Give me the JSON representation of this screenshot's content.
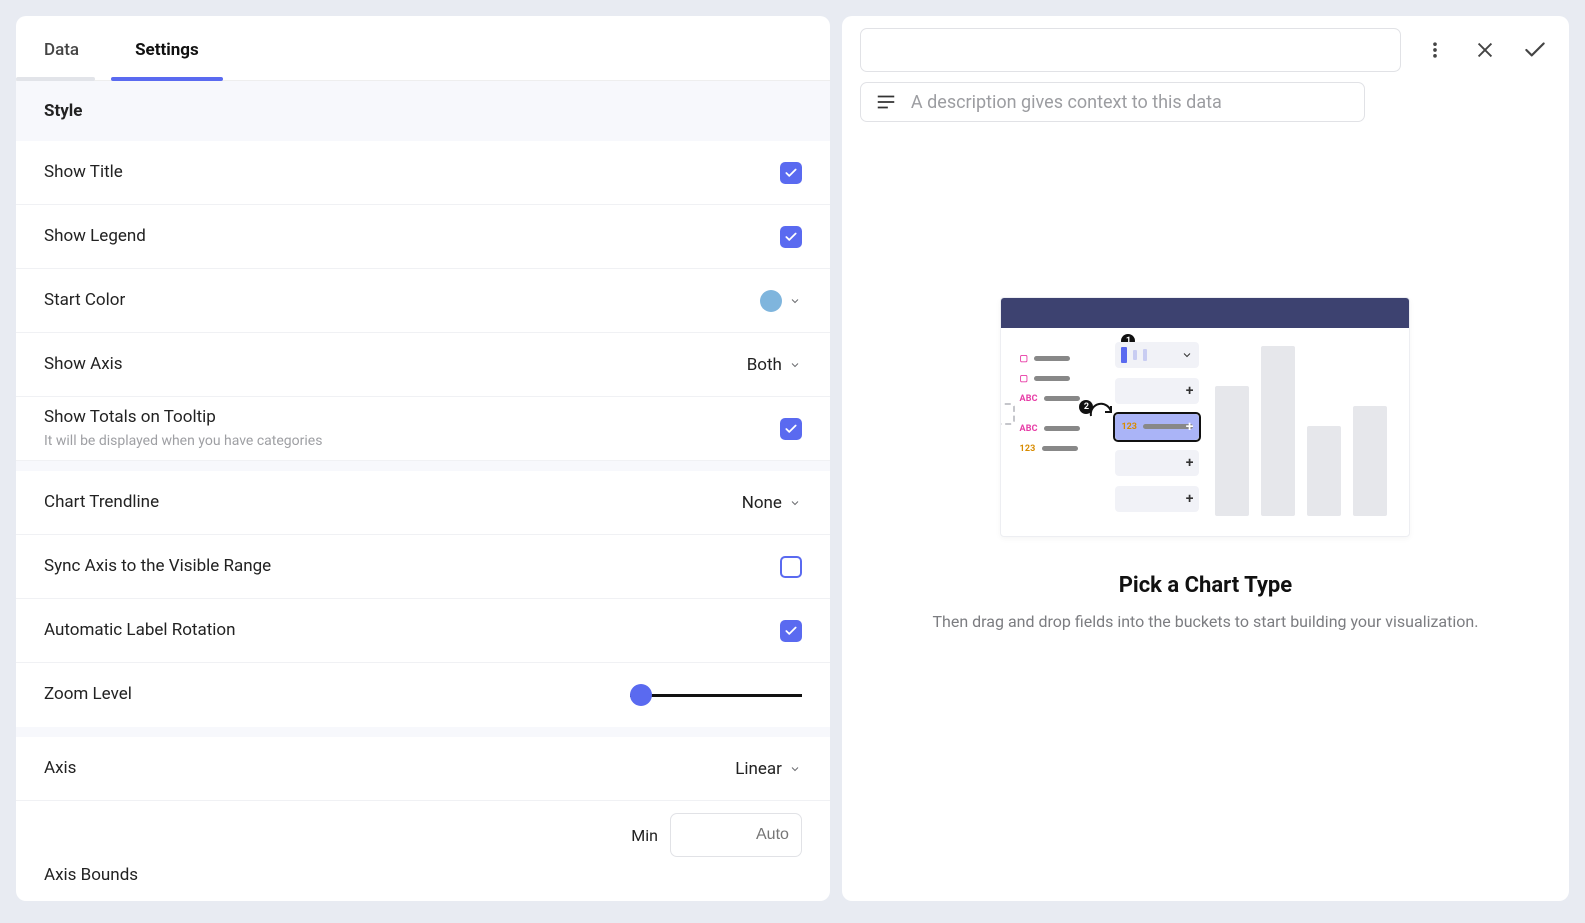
{
  "tabs": {
    "data": "Data",
    "settings": "Settings"
  },
  "style": {
    "header": "Style",
    "show_title": "Show Title",
    "show_legend": "Show Legend",
    "start_color": "Start Color",
    "start_color_value": "#7FB5DD",
    "show_axis": "Show Axis",
    "show_axis_value": "Both",
    "show_totals": "Show Totals on Tooltip",
    "show_totals_sub": "It will be displayed when you have categories",
    "chart_trendline": "Chart Trendline",
    "chart_trendline_value": "None",
    "sync_axis": "Sync Axis to the Visible Range",
    "auto_label_rotation": "Automatic Label Rotation",
    "zoom_level": "Zoom Level",
    "axis": "Axis",
    "axis_value": "Linear",
    "min_label": "Min",
    "min_placeholder": "Auto",
    "axis_bounds": "Axis Bounds"
  },
  "preview": {
    "description_placeholder": "A description gives context to this data",
    "empty_title": "Pick a Chart Type",
    "empty_sub": "Then drag and drop fields into the buckets to start building your visualization."
  }
}
